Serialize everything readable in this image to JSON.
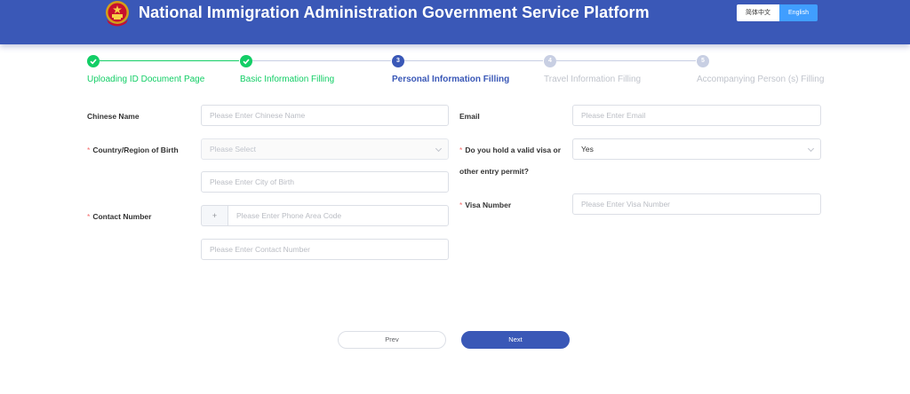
{
  "header": {
    "title": "National Immigration Administration Government Service Platform",
    "lang_zh": "简体中文",
    "lang_en": "English",
    "active_lang": "English",
    "bg_color": "#3a58b7"
  },
  "steps": [
    {
      "number": "1",
      "label": "Uploading ID Document Page",
      "status": "done"
    },
    {
      "number": "2",
      "label": "Basic Information Filling",
      "status": "done"
    },
    {
      "number": "3",
      "label": "Personal Information Filling",
      "status": "active"
    },
    {
      "number": "4",
      "label": "Travel Information Filling",
      "status": "pending"
    },
    {
      "number": "5",
      "label": "Accompanying Person (s) Filling",
      "status": "pending"
    }
  ],
  "colors": {
    "done": "#13ce66",
    "active": "#3a58b7",
    "pending": "#c8cfe3",
    "required": "#f56c6c"
  },
  "form": {
    "chinese_name": {
      "label": "Chinese Name",
      "placeholder": "Please Enter Chinese Name",
      "value": ""
    },
    "birth_country": {
      "label": "Country/Region of Birth",
      "required": true,
      "placeholder": "Please Select",
      "value": ""
    },
    "birth_city": {
      "placeholder": "Please Enter City of Birth",
      "value": ""
    },
    "contact_number": {
      "label": "Contact Number",
      "required": true,
      "prefix": "+",
      "area_code_placeholder": "Please Enter Phone Area Code",
      "number_placeholder": "Please Enter Contact Number"
    },
    "email": {
      "label": "Email",
      "placeholder": "Please Enter Email",
      "value": ""
    },
    "visa_held": {
      "label_line1": "Do you hold a valid visa or",
      "label_line2": "other entry permit?",
      "required": true,
      "value": "Yes"
    },
    "visa_number": {
      "label": "Visa Number",
      "required": true,
      "placeholder": "Please Enter Visa Number",
      "value": ""
    }
  },
  "buttons": {
    "prev": "Prev",
    "next": "Next"
  }
}
